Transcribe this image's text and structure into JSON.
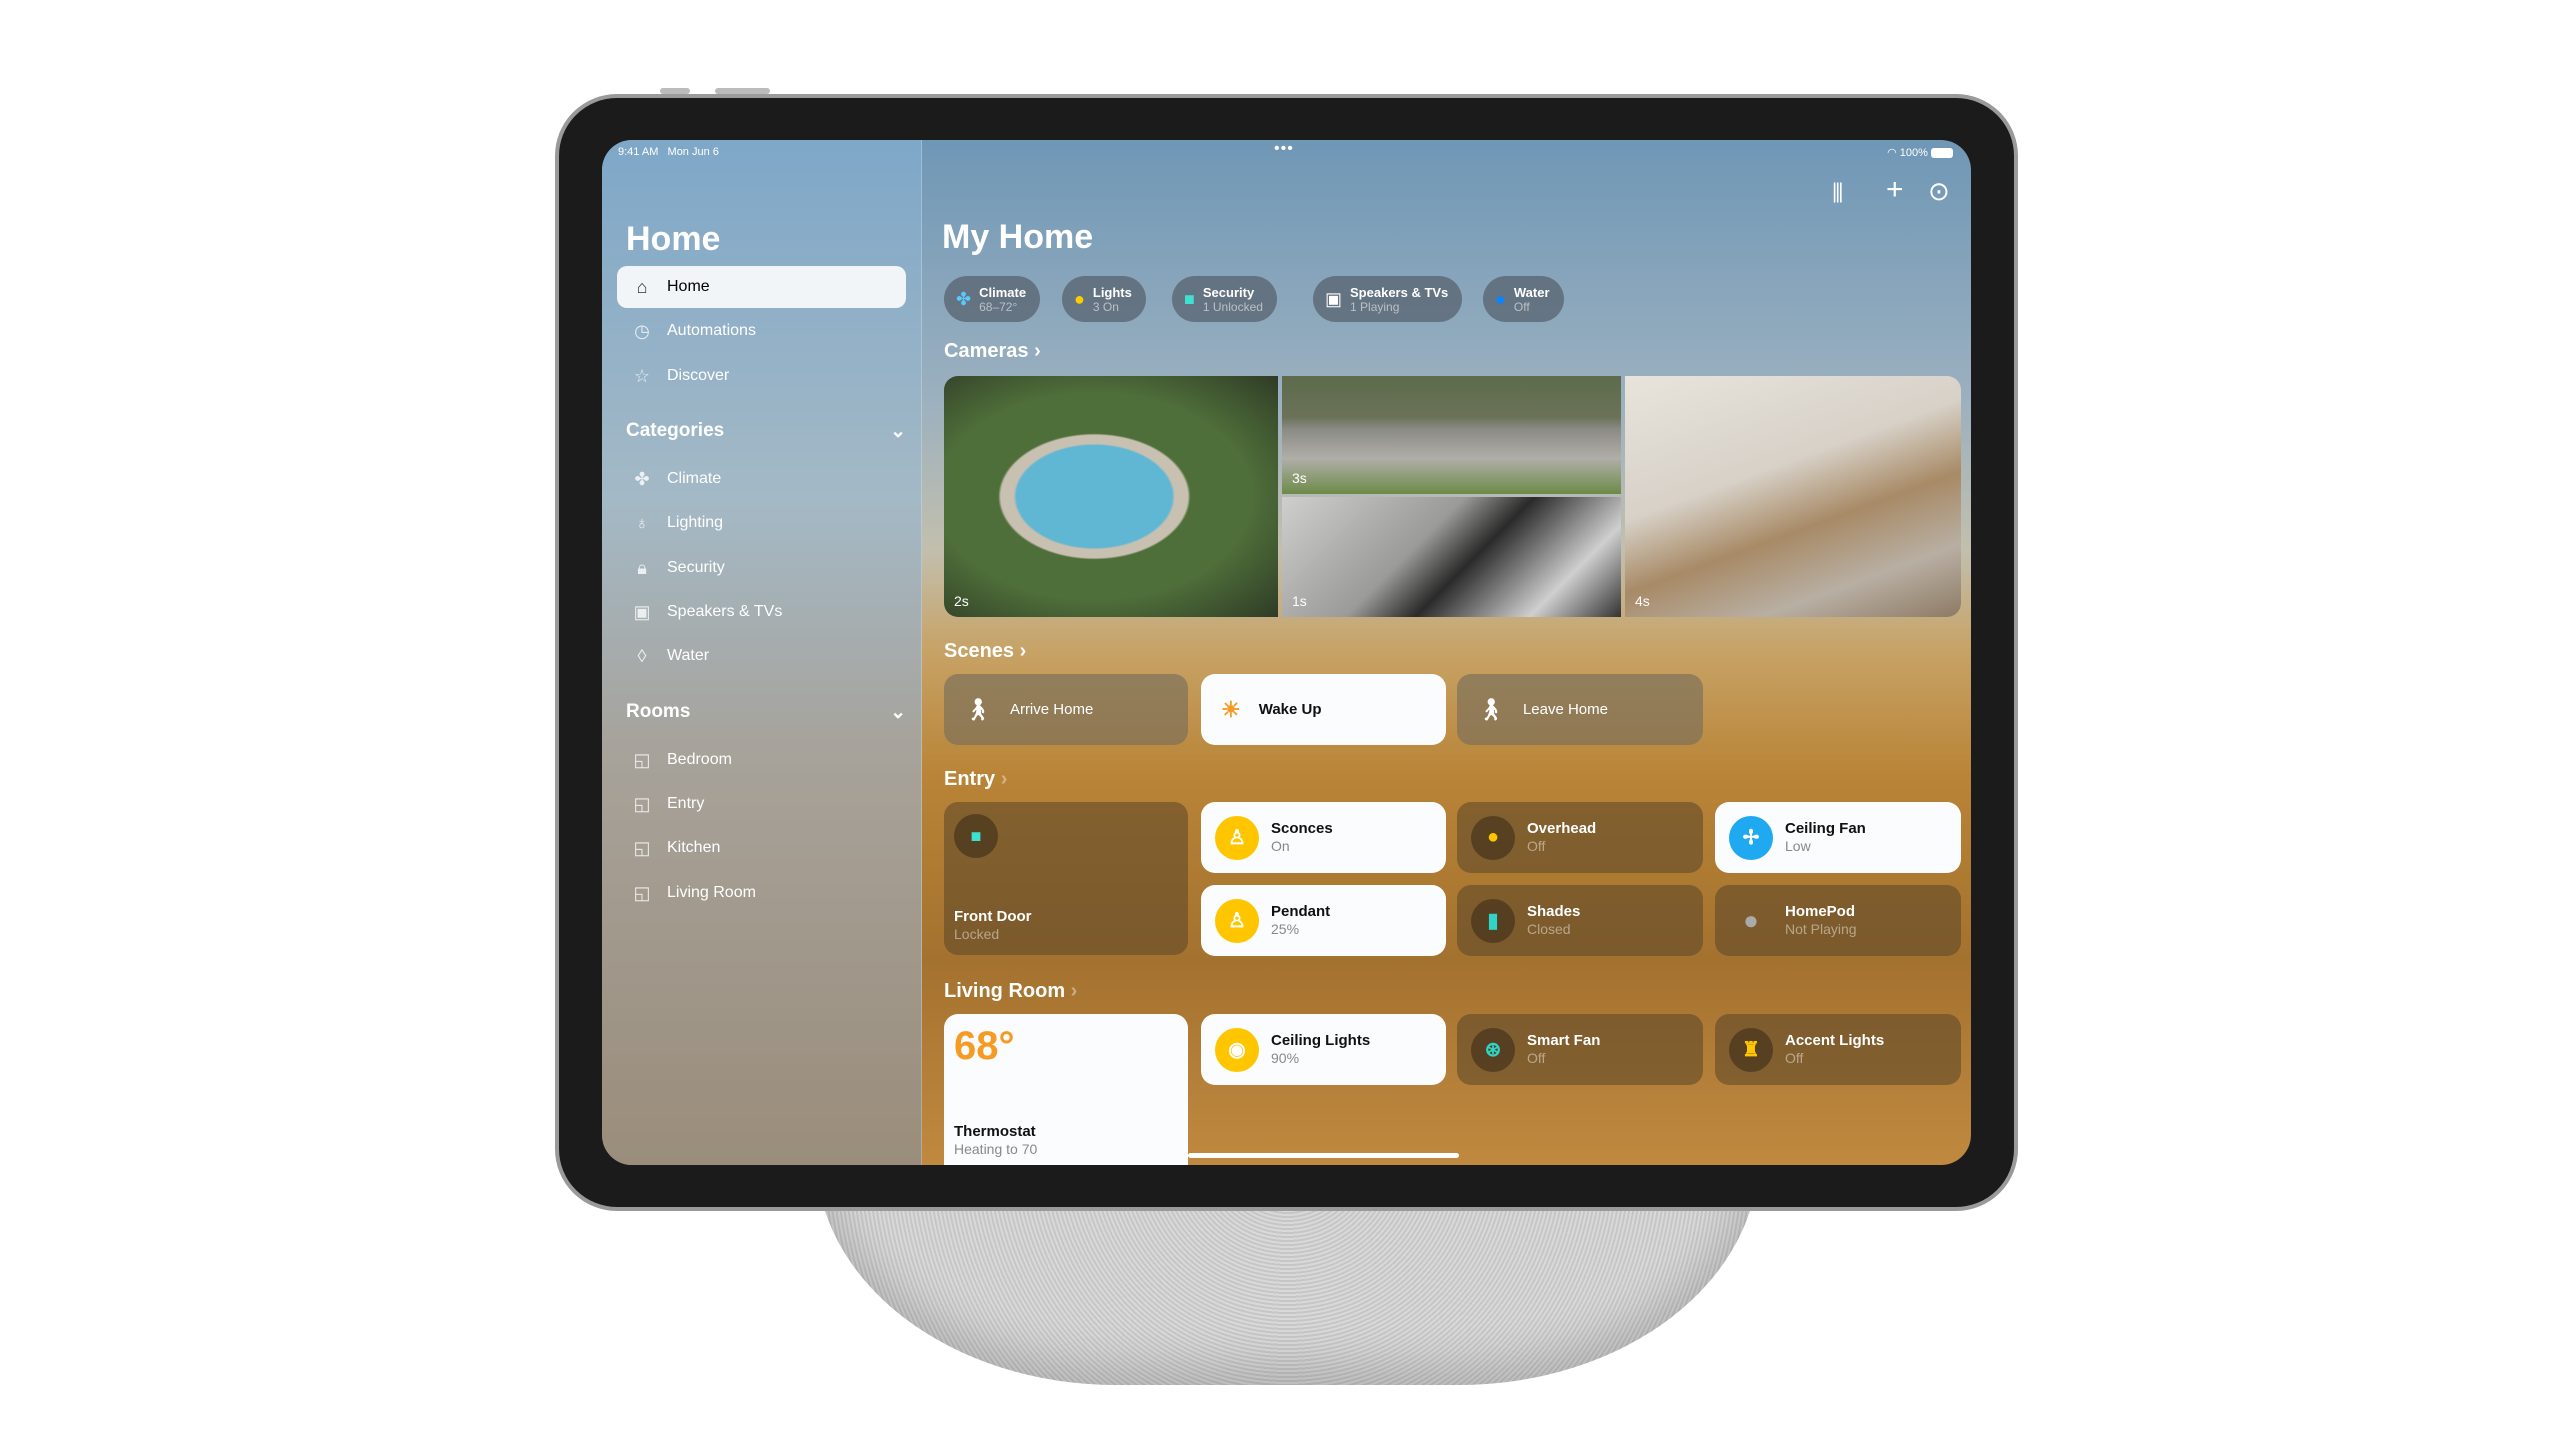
{
  "status": {
    "time": "9:41 AM",
    "date": "Mon Jun 6",
    "battery": "100%"
  },
  "sidebar": {
    "title": "Home",
    "items": [
      {
        "label": "Home",
        "icon": "house-icon"
      },
      {
        "label": "Automations",
        "icon": "clock-icon"
      },
      {
        "label": "Discover",
        "icon": "star-icon"
      }
    ],
    "categories_title": "Categories",
    "categories": [
      {
        "label": "Climate",
        "icon": "fan-icon"
      },
      {
        "label": "Lighting",
        "icon": "bulb-icon"
      },
      {
        "label": "Security",
        "icon": "lock-icon"
      },
      {
        "label": "Speakers & TVs",
        "icon": "speaker-icon"
      },
      {
        "label": "Water",
        "icon": "drop-icon"
      }
    ],
    "rooms_title": "Rooms",
    "rooms": [
      {
        "label": "Bedroom"
      },
      {
        "label": "Entry"
      },
      {
        "label": "Kitchen"
      },
      {
        "label": "Living Room"
      }
    ]
  },
  "main": {
    "title": "My Home",
    "chips": [
      {
        "title": "Climate",
        "sub": "68–72°",
        "color": "#5ac8fa"
      },
      {
        "title": "Lights",
        "sub": "3 On",
        "color": "#ffcc00"
      },
      {
        "title": "Security",
        "sub": "1 Unlocked",
        "color": "#40e0d0"
      },
      {
        "title": "Speakers & TVs",
        "sub": "1 Playing",
        "color": "#ffffff"
      },
      {
        "title": "Water",
        "sub": "Off",
        "color": "#0a84ff"
      }
    ],
    "cameras_title": "Cameras",
    "cameras": [
      {
        "label": "2s"
      },
      {
        "label": "3s"
      },
      {
        "label": "1s"
      },
      {
        "label": "4s"
      }
    ],
    "scenes_title": "Scenes",
    "scenes": [
      {
        "label": "Arrive Home"
      },
      {
        "label": "Wake Up"
      },
      {
        "label": "Leave Home"
      }
    ],
    "entry_title": "Entry",
    "entry": [
      {
        "name": "Front Door",
        "value": "Locked"
      },
      {
        "name": "Sconces",
        "value": "On"
      },
      {
        "name": "Overhead",
        "value": "Off"
      },
      {
        "name": "Ceiling Fan",
        "value": "Low"
      },
      {
        "name": "Pendant",
        "value": "25%"
      },
      {
        "name": "Shades",
        "value": "Closed"
      },
      {
        "name": "HomePod",
        "value": "Not Playing"
      }
    ],
    "living_title": "Living Room",
    "living": [
      {
        "name": "Thermostat",
        "value": "Heating to 70",
        "temp": "68°"
      },
      {
        "name": "Ceiling Lights",
        "value": "90%"
      },
      {
        "name": "Smart Fan",
        "value": "Off"
      },
      {
        "name": "Accent Lights",
        "value": "Off"
      }
    ]
  },
  "colors": {
    "accent_yellow": "#ffc600",
    "accent_blue": "#1fa9f0",
    "temp_orange": "#f59a23"
  }
}
